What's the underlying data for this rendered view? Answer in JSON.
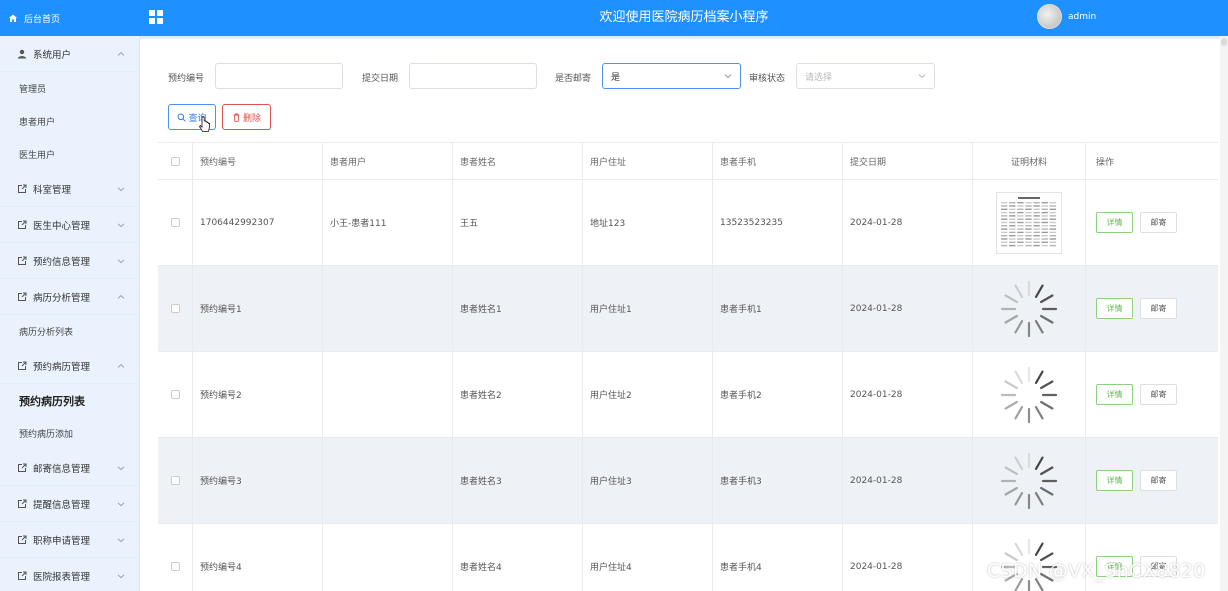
{
  "header": {
    "home_label": "后台首页",
    "title": "欢迎使用医院病历档案小程序",
    "user_name": "admin",
    "brand_color": "#1e90ff"
  },
  "sidebar": {
    "items": [
      {
        "label": "系统用户",
        "icon": "user-icon",
        "expanded": true,
        "children": [
          "管理员",
          "患者用户",
          "医生用户"
        ]
      },
      {
        "label": "科室管理",
        "icon": "external-link-icon",
        "expanded": false
      },
      {
        "label": "医生中心管理",
        "icon": "external-link-icon",
        "expanded": false
      },
      {
        "label": "预约信息管理",
        "icon": "external-link-icon",
        "expanded": false
      },
      {
        "label": "病历分析管理",
        "icon": "external-link-icon",
        "expanded": true,
        "children": [
          "病历分析列表"
        ]
      },
      {
        "label": "预约病历管理",
        "icon": "external-link-icon",
        "expanded": true,
        "children": [
          "预约病历列表",
          "预约病历添加"
        ],
        "active_child": "预约病历列表"
      },
      {
        "label": "邮寄信息管理",
        "icon": "external-link-icon",
        "expanded": false
      },
      {
        "label": "提醒信息管理",
        "icon": "external-link-icon",
        "expanded": false
      },
      {
        "label": "职称申请管理",
        "icon": "external-link-icon",
        "expanded": false
      },
      {
        "label": "医院报表管理",
        "icon": "external-link-icon",
        "expanded": false
      }
    ]
  },
  "filters": {
    "appointment_no_label": "预约编号",
    "appointment_no_value": "",
    "submit_date_label": "提交日期",
    "submit_date_value": "",
    "mailed_label": "是否邮寄",
    "mailed_value": "是",
    "review_status_label": "审核状态",
    "review_status_placeholder": "请选择"
  },
  "actions": {
    "query_label": "查询",
    "delete_label": "删除"
  },
  "table": {
    "columns": [
      "预约编号",
      "患者用户",
      "患者姓名",
      "用户住址",
      "患者手机",
      "提交日期",
      "证明材料",
      "操作"
    ],
    "rows": [
      {
        "no": "1706442992307",
        "user": "小王-患者111",
        "name": "王五",
        "address": "地址123",
        "phone": "13523523235",
        "date": "2024-01-28",
        "material": "document-thumbnail"
      },
      {
        "no": "预约编号1",
        "user": "",
        "name": "患者姓名1",
        "address": "用户住址1",
        "phone": "患者手机1",
        "date": "2024-01-28",
        "material": "loading-spinner"
      },
      {
        "no": "预约编号2",
        "user": "",
        "name": "患者姓名2",
        "address": "用户住址2",
        "phone": "患者手机2",
        "date": "2024-01-28",
        "material": "loading-spinner"
      },
      {
        "no": "预约编号3",
        "user": "",
        "name": "患者姓名3",
        "address": "用户住址3",
        "phone": "患者手机3",
        "date": "2024-01-28",
        "material": "loading-spinner"
      },
      {
        "no": "预约编号4",
        "user": "",
        "name": "患者姓名4",
        "address": "用户住址4",
        "phone": "患者手机4",
        "date": "2024-01-28",
        "material": "loading-spinner"
      }
    ],
    "detail_label": "详情",
    "mail_label": "邮寄"
  },
  "watermark": "CSDN @VX_ShCX8820"
}
